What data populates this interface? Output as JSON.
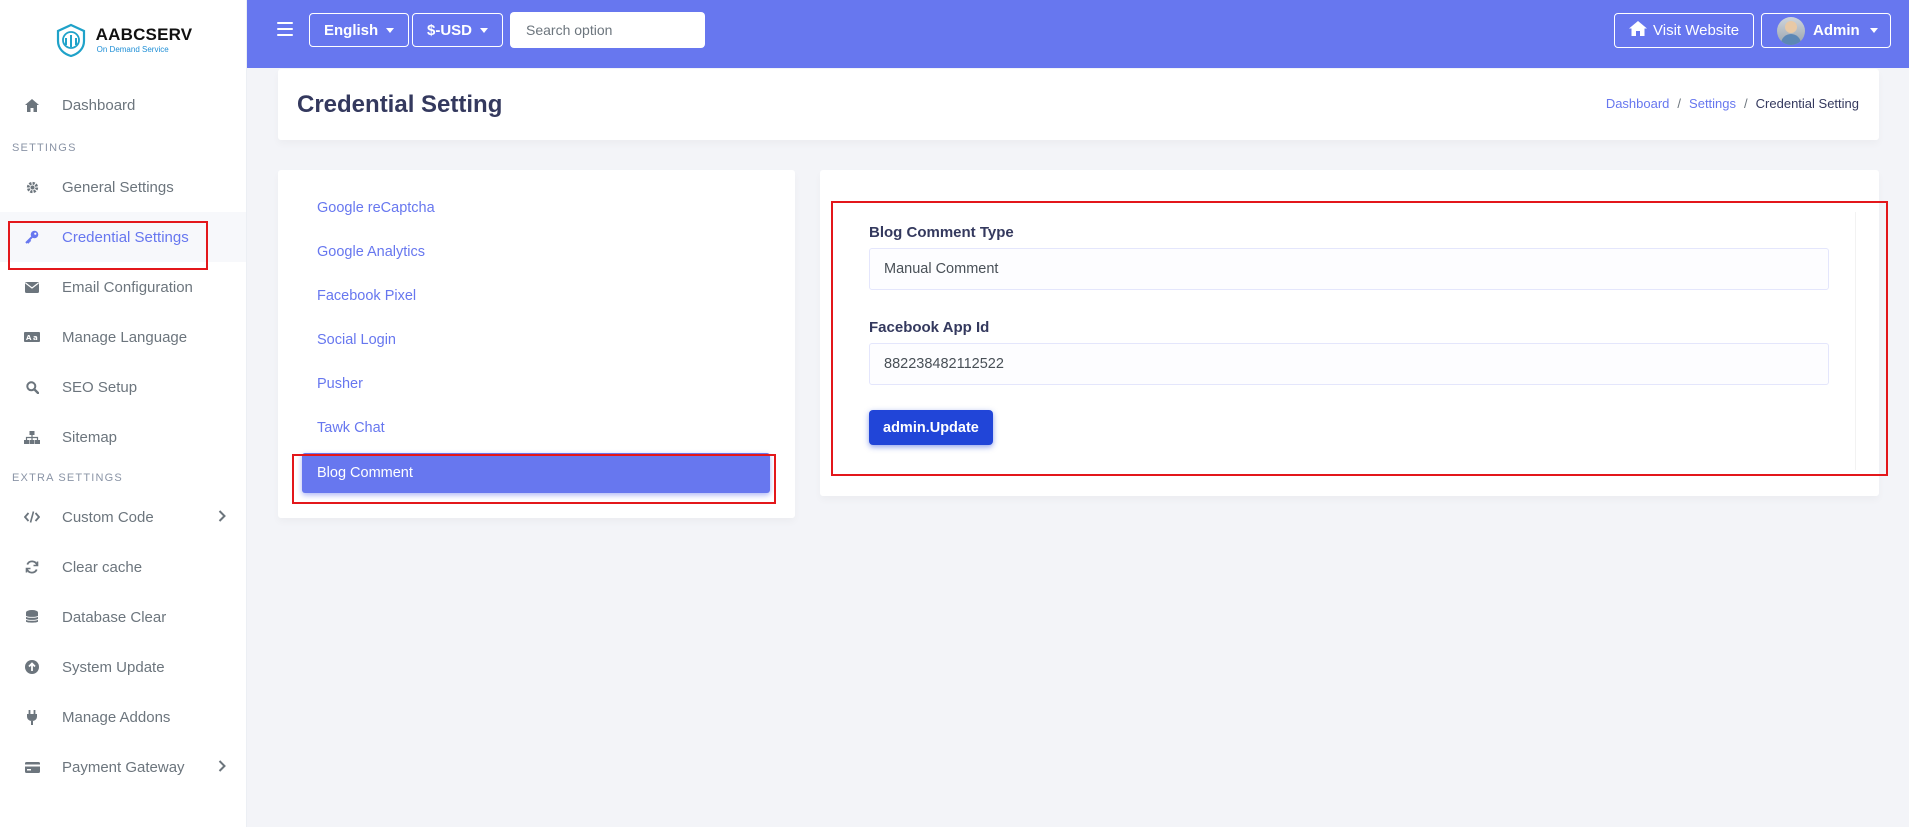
{
  "brand": {
    "name": "AABCSERV",
    "tagline": "On Demand Service"
  },
  "sidebar": {
    "items_top": [
      {
        "label": "Dashboard",
        "icon": "home-icon"
      }
    ],
    "settings_header": "SETTINGS",
    "settings_items": [
      {
        "label": "General Settings",
        "icon": "gear-icon"
      },
      {
        "label": "Credential Settings",
        "icon": "key-icon",
        "active": true
      },
      {
        "label": "Email Configuration",
        "icon": "envelope-icon"
      },
      {
        "label": "Manage Language",
        "icon": "language-icon"
      },
      {
        "label": "SEO Setup",
        "icon": "search-icon"
      },
      {
        "label": "Sitemap",
        "icon": "sitemap-icon"
      }
    ],
    "extra_header": "EXTRA SETTINGS",
    "extra_items": [
      {
        "label": "Custom Code",
        "icon": "code-icon",
        "has_submenu": true
      },
      {
        "label": "Clear cache",
        "icon": "sync-icon"
      },
      {
        "label": "Database Clear",
        "icon": "database-icon"
      },
      {
        "label": "System Update",
        "icon": "upload-icon"
      },
      {
        "label": "Manage Addons",
        "icon": "plug-icon"
      },
      {
        "label": "Payment Gateway",
        "icon": "credit-card-icon",
        "has_submenu": true
      }
    ]
  },
  "topbar": {
    "language": "English",
    "currency": "$-USD",
    "search_placeholder": "Search option",
    "visit_website": "Visit Website",
    "user": "Admin",
    "accent": "#6777ef"
  },
  "page": {
    "title": "Credential Setting",
    "breadcrumb": [
      "Dashboard",
      "Settings",
      "Credential Setting"
    ]
  },
  "credential_nav": {
    "items": [
      "Google reCaptcha",
      "Google Analytics",
      "Facebook Pixel",
      "Social Login",
      "Pusher",
      "Tawk Chat",
      "Blog Comment"
    ],
    "active": "Blog Comment"
  },
  "form": {
    "comment_type_label": "Blog Comment Type",
    "comment_type_value": "Manual Comment",
    "fb_app_id_label": "Facebook App Id",
    "fb_app_id_value": "882238482112522",
    "submit_label": "admin.Update"
  },
  "highlight_color": "#e3171b"
}
